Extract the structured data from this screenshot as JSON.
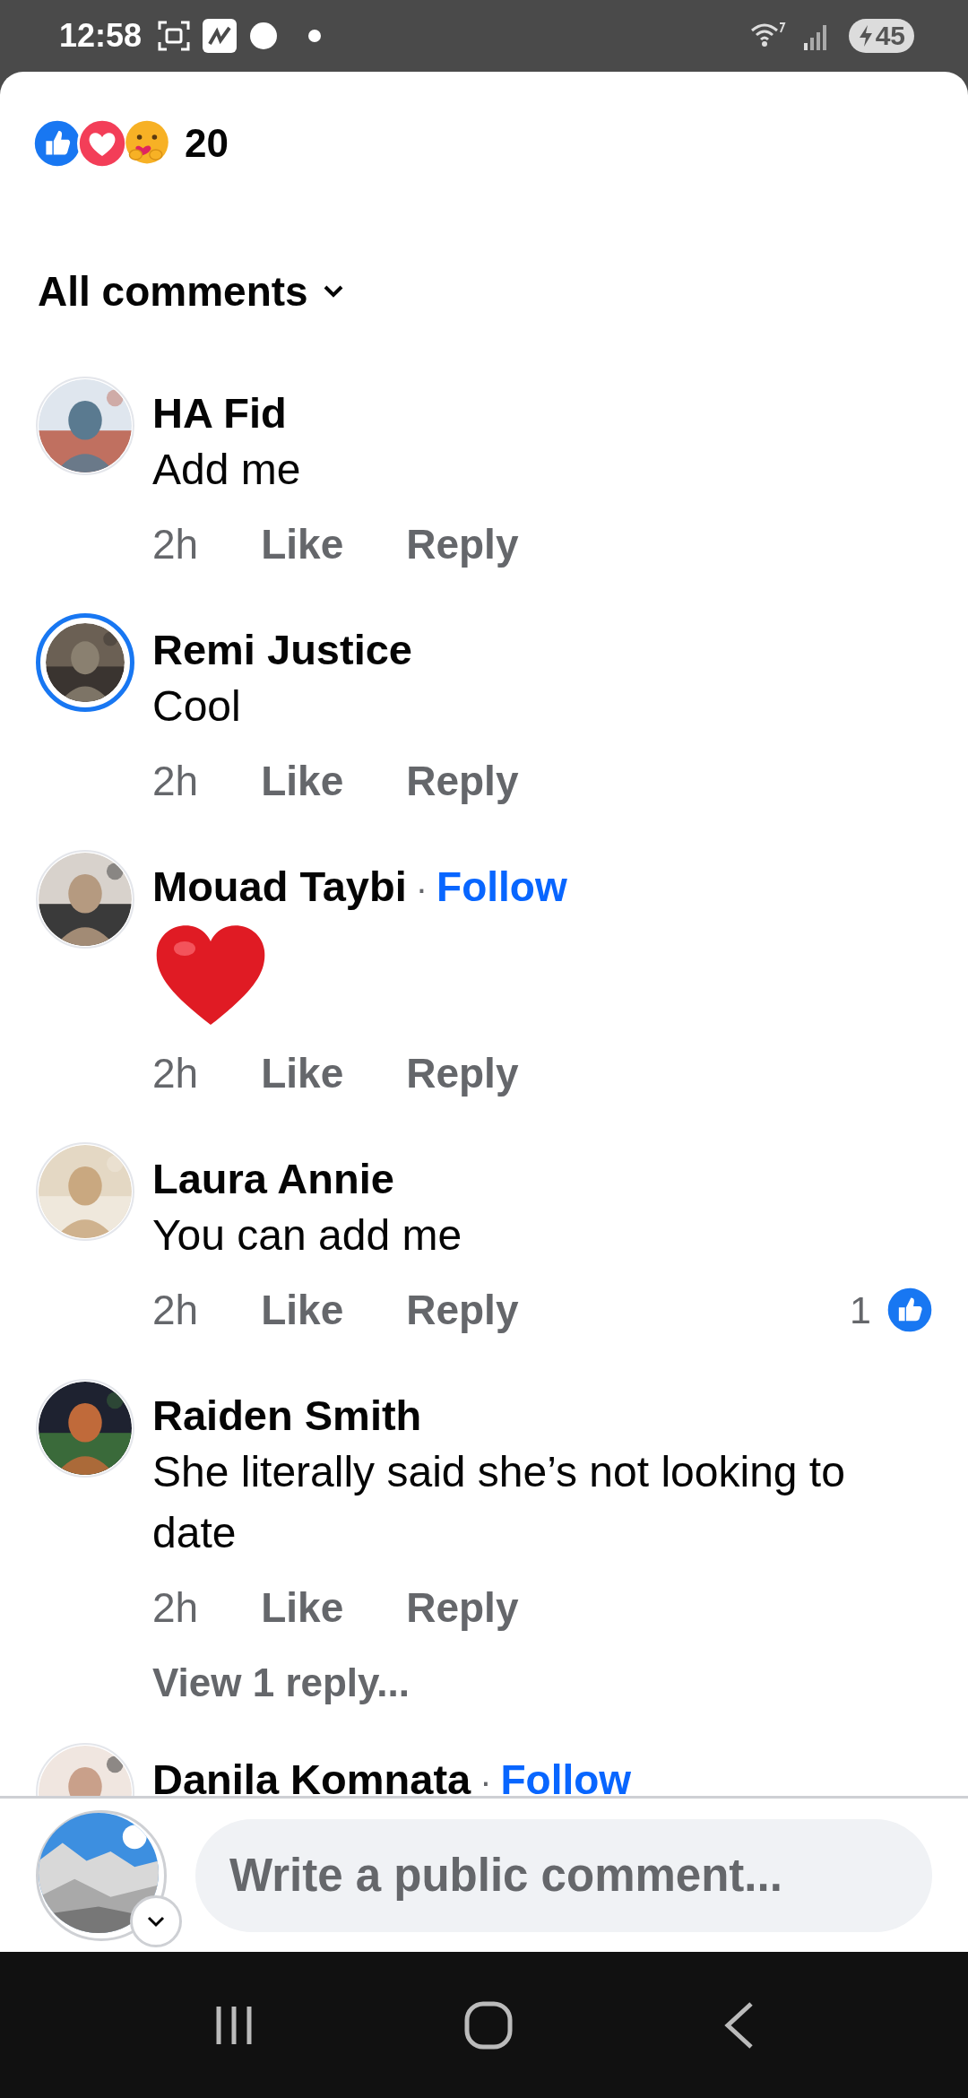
{
  "status_bar": {
    "time": "12:58",
    "battery": "45"
  },
  "reactions": {
    "count": "20"
  },
  "filter": {
    "label": "All comments"
  },
  "comments": [
    {
      "name": "HA Fid",
      "story": false,
      "kind": "text",
      "body": "Add me",
      "time": "2h",
      "like": "Like",
      "reply": "Reply"
    },
    {
      "name": "Remi Justice",
      "story": true,
      "kind": "text",
      "body": "Cool",
      "time": "2h",
      "like": "Like",
      "reply": "Reply"
    },
    {
      "name": "Mouad Taybi",
      "story": false,
      "follow": {
        "separator": "·",
        "label": "Follow"
      },
      "kind": "heart",
      "time": "2h",
      "like": "Like",
      "reply": "Reply"
    },
    {
      "name": "Laura Annie",
      "story": false,
      "kind": "text",
      "body": "You can add me",
      "time": "2h",
      "like": "Like",
      "reply": "Reply",
      "like_count": "1"
    },
    {
      "name": "Raiden Smith",
      "story": false,
      "kind": "text",
      "body": "She literally said she’s not looking to date",
      "time": "2h",
      "like": "Like",
      "reply": "Reply",
      "view_replies": "View 1 reply..."
    },
    {
      "name": "Danila Komnata",
      "story": false,
      "follow": {
        "separator": "·",
        "label": "Follow"
      },
      "kind": "partial"
    }
  ],
  "composer": {
    "placeholder": "Write a public comment..."
  }
}
